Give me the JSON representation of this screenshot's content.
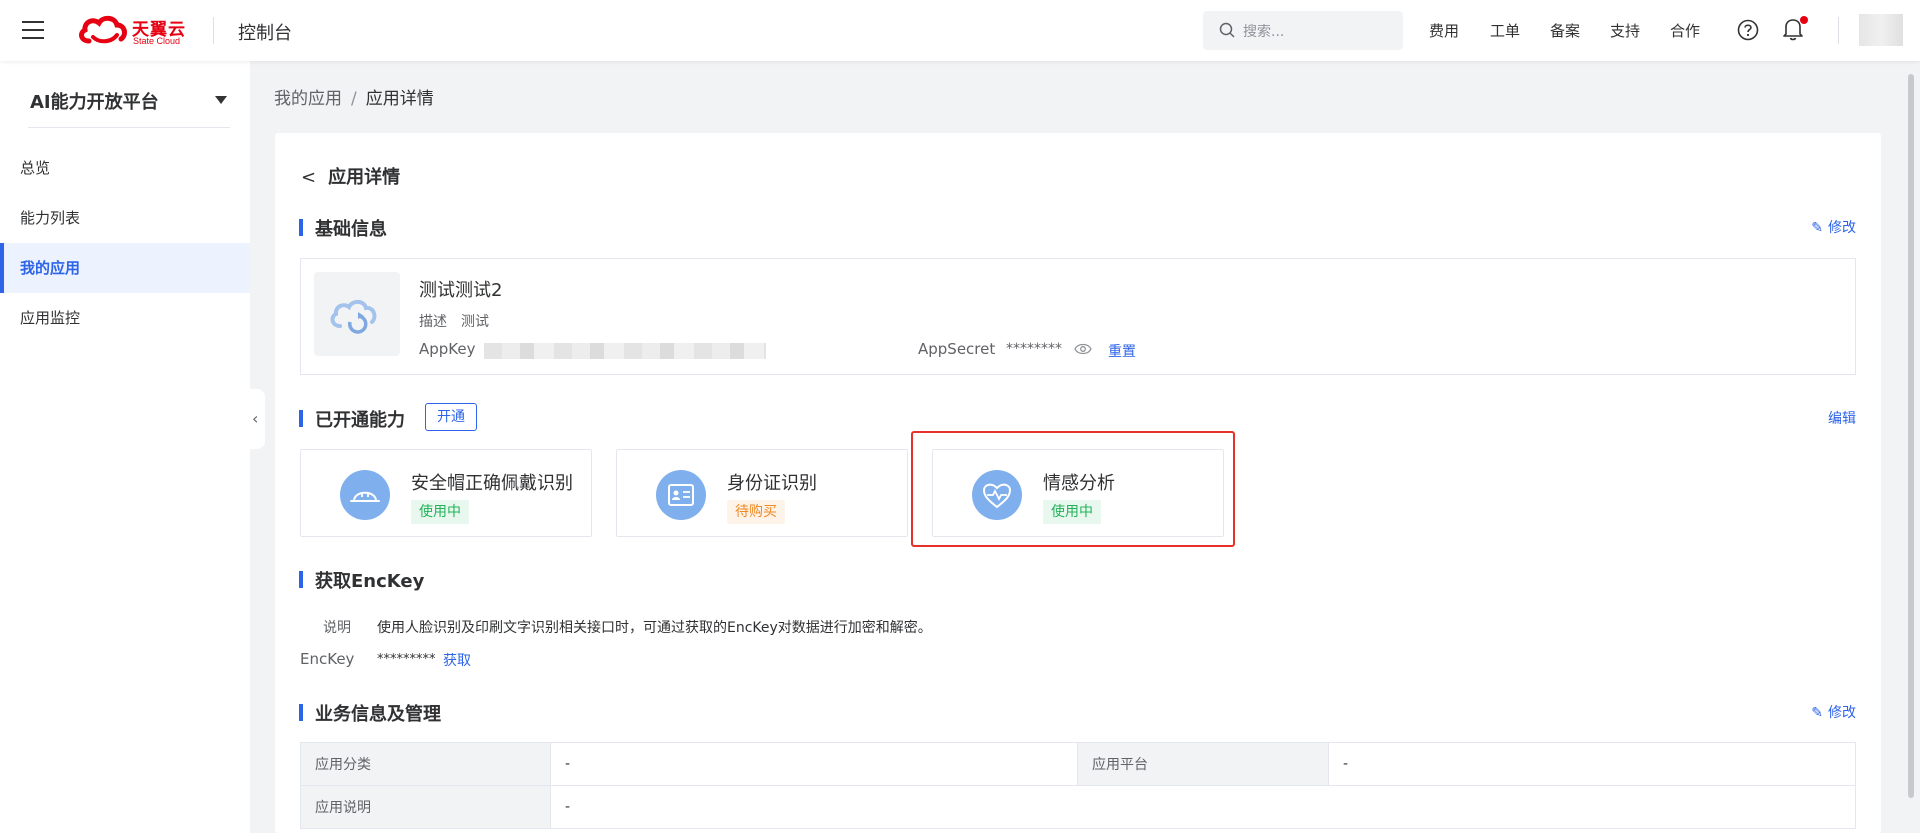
{
  "header": {
    "logo_cn": "天翼云",
    "logo_en": "State Cloud",
    "console": "控制台",
    "search_placeholder": "搜索...",
    "nav": [
      "费用",
      "工单",
      "备案",
      "支持",
      "合作"
    ],
    "accent": "#2d64e8",
    "brand": "#e60012"
  },
  "sidebar": {
    "title": "AI能力开放平台",
    "items": [
      {
        "label": "总览",
        "active": false
      },
      {
        "label": "能力列表",
        "active": false
      },
      {
        "label": "我的应用",
        "active": true
      },
      {
        "label": "应用监控",
        "active": false
      }
    ]
  },
  "breadcrumb": {
    "parent": "我的应用",
    "separator": "/",
    "current": "应用详情"
  },
  "page": {
    "back_title": "应用详情"
  },
  "basic": {
    "title": "基础信息",
    "edit": "修改",
    "app_name": "测试测试2",
    "desc_label": "描述",
    "desc_value": "测试",
    "appkey_label": "AppKey",
    "appsecret_label": "AppSecret",
    "appsecret_value": "********",
    "reset": "重置"
  },
  "capabilities": {
    "title": "已开通能力",
    "open_button": "开通",
    "edit": "编辑",
    "items": [
      {
        "name": "安全帽正确佩戴识别",
        "status": "使用中",
        "status_type": "green",
        "icon": "helmet-icon"
      },
      {
        "name": "身份证识别",
        "status": "待购买",
        "status_type": "orange",
        "icon": "id-card-icon"
      },
      {
        "name": "情感分析",
        "status": "使用中",
        "status_type": "green",
        "icon": "heartbeat-icon"
      }
    ]
  },
  "enckey": {
    "title": "获取EncKey",
    "desc_label": "说明",
    "desc_text": "使用人脸识别及印刷文字识别相关接口时，可通过获取的EncKey对数据进行加密和解密。",
    "label": "EncKey",
    "value": "*********",
    "get": "获取"
  },
  "business": {
    "title": "业务信息及管理",
    "edit": "修改",
    "rows": [
      {
        "label1": "应用分类",
        "value1": "-",
        "label2": "应用平台",
        "value2": "-"
      },
      {
        "label1": "应用说明",
        "value1": "-"
      }
    ]
  }
}
